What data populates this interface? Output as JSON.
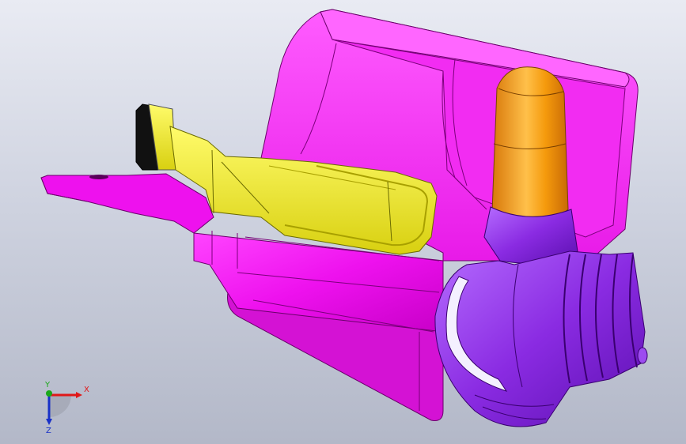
{
  "viewport": {
    "background_top": "#e9ebf3",
    "background_bottom": "#b3b8c8"
  },
  "parts": {
    "tank_color": "#ee11ee",
    "bracket_color": "#f4f02a",
    "cap_color": "#f59a0c",
    "duct_color": "#8a2be2"
  },
  "triad": {
    "x_label": "X",
    "y_label": "Y",
    "z_label": "Z",
    "x_color": "#e01818",
    "y_color": "#1aa81a",
    "z_color": "#1830c8"
  }
}
